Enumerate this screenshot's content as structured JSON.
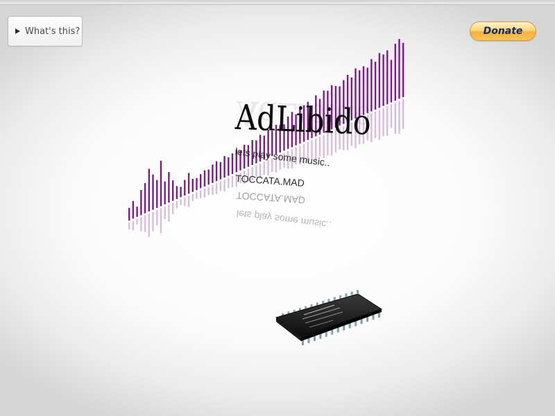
{
  "whats_this": {
    "label": "What's this?",
    "icon": "play-triangle-icon"
  },
  "donate": {
    "label": "Donate",
    "accent": "#f7b13b",
    "text_color": "#102a6b"
  },
  "logo": {
    "text": "AdLibido"
  },
  "tagline": {
    "text": "lets play some music.."
  },
  "track": {
    "name": "TOCCATA.MAD"
  },
  "visualizer": {
    "bar_color": "#7a1e86",
    "bar_levels": [
      0.2,
      0.3,
      0.15,
      0.45,
      0.55,
      0.8,
      0.65,
      0.5,
      0.85,
      0.4,
      0.55,
      0.35,
      0.2,
      0.15,
      0.25,
      0.35,
      0.2,
      0.18,
      0.22,
      0.26,
      0.24,
      0.3,
      0.33,
      0.28,
      0.36,
      0.3,
      0.34,
      0.38,
      0.32,
      0.4,
      0.36,
      0.42,
      0.38,
      0.45,
      0.4,
      0.48,
      0.42,
      0.5,
      0.46,
      0.44,
      0.55,
      0.6,
      0.52,
      0.58,
      0.62,
      0.65,
      0.55,
      0.7,
      0.6,
      0.72,
      0.68,
      0.75,
      0.7,
      0.66,
      0.74,
      0.8,
      0.72,
      0.85,
      0.78,
      0.82,
      0.76,
      0.88,
      0.8,
      0.92,
      0.86,
      0.9,
      0.7,
      0.95,
      1.0,
      0.9
    ]
  },
  "chip": {
    "icon": "ic-chip-icon"
  }
}
